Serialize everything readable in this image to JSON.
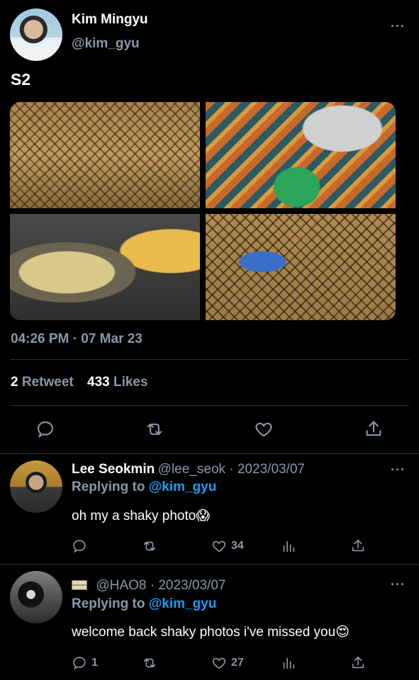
{
  "tweet": {
    "author_name": "Kim Mingyu",
    "author_handle": "@kim_gyu",
    "text": "S2",
    "timestamp": "04:26 PM · 07 Mar 23",
    "retweet_count": "2",
    "retweet_label": "Retweet",
    "like_count": "433",
    "like_label": "Likes",
    "more": "···"
  },
  "replies": [
    {
      "name": "Lee Seokmin",
      "meta": "@lee_seok · 2023/03/07",
      "replying_prefix": "Replying to ",
      "replying_to": "@kim_gyu",
      "text": "oh my a shaky photo😱",
      "reply_count": "",
      "like_count": "34",
      "more": "···"
    },
    {
      "name": "",
      "meta": "@HAO8 · 2023/03/07",
      "replying_prefix": "Replying to ",
      "replying_to": "@kim_gyu",
      "text": "welcome back shaky photos i've missed you😍",
      "reply_count": "1",
      "like_count": "27",
      "more": "···"
    }
  ],
  "icons": {
    "reply": "reply-icon",
    "retweet": "retweet-icon",
    "like": "heart-icon",
    "share": "share-icon",
    "views": "analytics-icon"
  },
  "colors": {
    "background": "#000000",
    "muted": "#8b98a5",
    "link": "#1d9bf0",
    "divider": "#2f3336"
  }
}
